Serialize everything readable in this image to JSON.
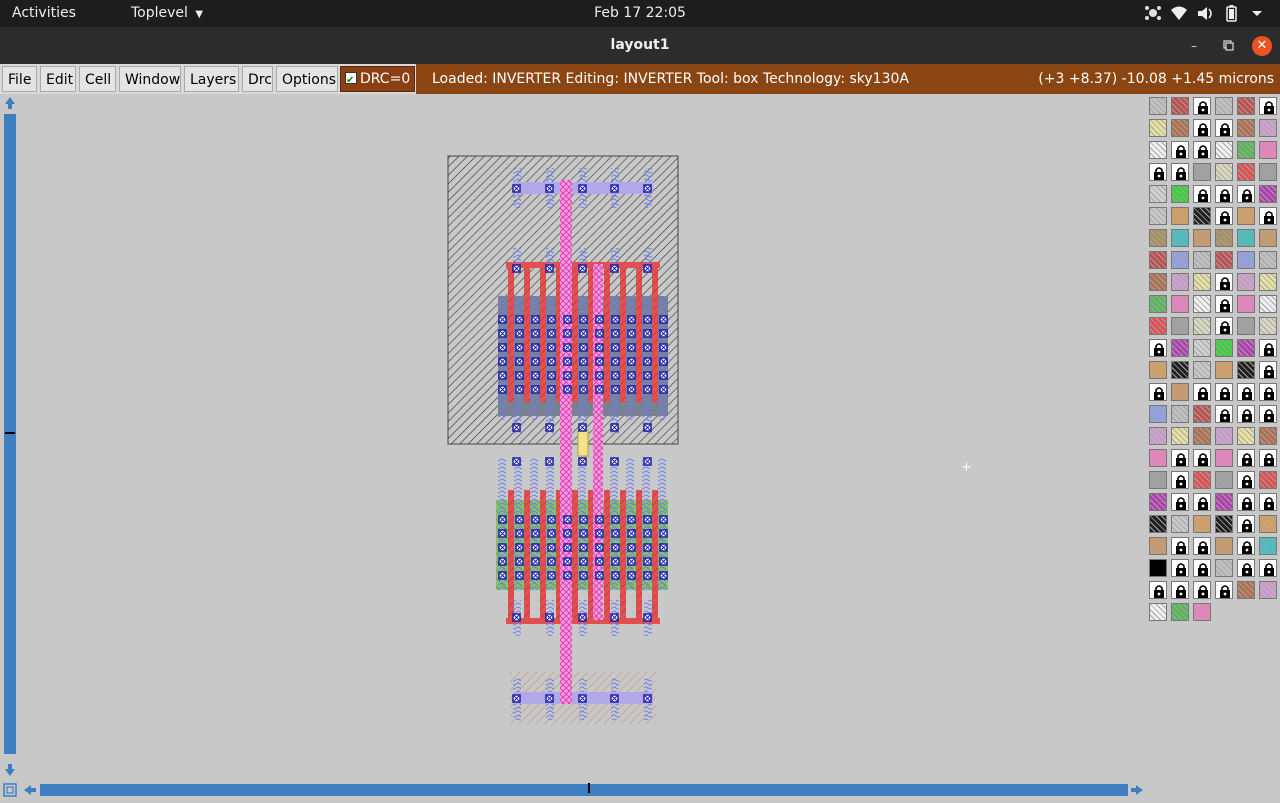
{
  "topbar": {
    "activities": "Activities",
    "toplevel": "Toplevel",
    "clock": "Feb 17  22:05",
    "icons": [
      "network-graph-icon",
      "wifi-icon",
      "volume-icon",
      "battery-icon",
      "power-menu-icon"
    ]
  },
  "window": {
    "title": "layout1",
    "controls": [
      "minimize-icon",
      "maximize-icon",
      "close-icon"
    ]
  },
  "menubar": {
    "items": [
      "File",
      "Edit",
      "Cell",
      "Window",
      "Layers",
      "Drc",
      "Options"
    ],
    "drc_label": "DRC=0",
    "drc_checked": true
  },
  "status": {
    "left": "Loaded: INVERTER Editing: INVERTER Tool: box  Technology: sky130A",
    "right": "(+3 +8.37) -10.08 +1.45 microns"
  },
  "colors": {
    "status_bg": "#8b4513",
    "drc_bg": "#8b3f12",
    "scroll_accent": "#3f7fc1",
    "canvas_bg": "#c8c8c8",
    "poly": "#e05050",
    "local_interconnect": "#e870c8",
    "metal1": "#9aa8f0",
    "contact": "#1a1aa0",
    "diffusion": "#58c858"
  },
  "palette": {
    "columns": 6,
    "rows": 24
  }
}
